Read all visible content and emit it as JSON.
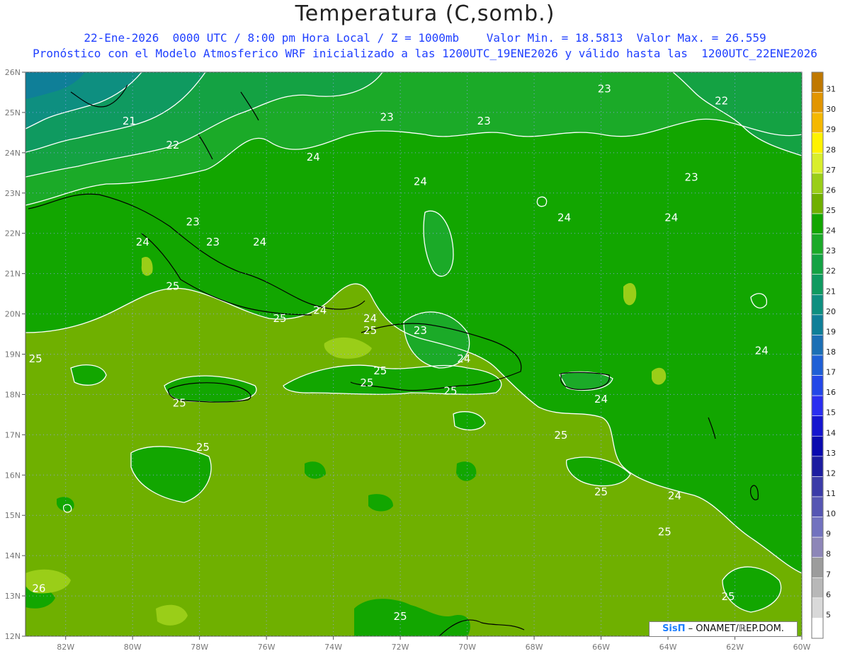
{
  "header": {
    "title": "Temperatura (C,somb.)",
    "line1": "22-Ene-2026  0000 UTC / 8:00 pm Hora Local / Z = 1000mb    Valor Min. = 18.5813  Valor Max. = 26.559",
    "line2": "Pronóstico con el Modelo Atmosferico WRF inicializado a las 1200UTC_19ENE2026 y válido hasta las  1200UTC_22ENE2026"
  },
  "map": {
    "lon_range": [
      -83.2,
      -60
    ],
    "lat_range": [
      12,
      26
    ],
    "lon_ticks": [
      {
        "lon": -82,
        "label": "82W"
      },
      {
        "lon": -80,
        "label": "80W"
      },
      {
        "lon": -78,
        "label": "78W"
      },
      {
        "lon": -76,
        "label": "76W"
      },
      {
        "lon": -74,
        "label": "74W"
      },
      {
        "lon": -72,
        "label": "72W"
      },
      {
        "lon": -70,
        "label": "70W"
      },
      {
        "lon": -68,
        "label": "68W"
      },
      {
        "lon": -66,
        "label": "66W"
      },
      {
        "lon": -64,
        "label": "64W"
      },
      {
        "lon": -62,
        "label": "62W"
      },
      {
        "lon": -60,
        "label": "60W"
      }
    ],
    "lat_ticks": [
      {
        "lat": 26,
        "label": "26N"
      },
      {
        "lat": 25,
        "label": "25N"
      },
      {
        "lat": 24,
        "label": "24N"
      },
      {
        "lat": 23,
        "label": "23N"
      },
      {
        "lat": 22,
        "label": "22N"
      },
      {
        "lat": 21,
        "label": "21N"
      },
      {
        "lat": 20,
        "label": "20N"
      },
      {
        "lat": 19,
        "label": "19N"
      },
      {
        "lat": 18,
        "label": "18N"
      },
      {
        "lat": 17,
        "label": "17N"
      },
      {
        "lat": 16,
        "label": "16N"
      },
      {
        "lat": 15,
        "label": "15N"
      },
      {
        "lat": 14,
        "label": "14N"
      },
      {
        "lat": 13,
        "label": "13N"
      },
      {
        "lat": 12,
        "label": "12N"
      }
    ],
    "contour_labels": [
      {
        "lon": -80.1,
        "lat": 24.7,
        "text": "21"
      },
      {
        "lon": -78.8,
        "lat": 24.1,
        "text": "22"
      },
      {
        "lon": -78.2,
        "lat": 22.2,
        "text": "23"
      },
      {
        "lon": -77.6,
        "lat": 21.7,
        "text": "23"
      },
      {
        "lon": -79.7,
        "lat": 21.7,
        "text": "24"
      },
      {
        "lon": -76.2,
        "lat": 21.7,
        "text": "24"
      },
      {
        "lon": -74.6,
        "lat": 23.8,
        "text": "24"
      },
      {
        "lon": -71.4,
        "lat": 23.2,
        "text": "24"
      },
      {
        "lon": -72.4,
        "lat": 24.8,
        "text": "23"
      },
      {
        "lon": -69.5,
        "lat": 24.7,
        "text": "23"
      },
      {
        "lon": -65.9,
        "lat": 25.5,
        "text": "23"
      },
      {
        "lon": -62.4,
        "lat": 25.2,
        "text": "22"
      },
      {
        "lon": -63.3,
        "lat": 23.3,
        "text": "23"
      },
      {
        "lon": -67.1,
        "lat": 22.3,
        "text": "24"
      },
      {
        "lon": -63.9,
        "lat": 22.3,
        "text": "24"
      },
      {
        "lon": -78.8,
        "lat": 20.6,
        "text": "25"
      },
      {
        "lon": -75.6,
        "lat": 19.8,
        "text": "25"
      },
      {
        "lon": -74.4,
        "lat": 20.0,
        "text": "24"
      },
      {
        "lon": -72.9,
        "lat": 19.8,
        "text": "24"
      },
      {
        "lon": -72.9,
        "lat": 19.5,
        "text": "25"
      },
      {
        "lon": -71.4,
        "lat": 19.5,
        "text": "23"
      },
      {
        "lon": -70.1,
        "lat": 18.8,
        "text": "24"
      },
      {
        "lon": -73.0,
        "lat": 18.2,
        "text": "25"
      },
      {
        "lon": -72.6,
        "lat": 18.5,
        "text": "25"
      },
      {
        "lon": -70.5,
        "lat": 18.0,
        "text": "25"
      },
      {
        "lon": -66.0,
        "lat": 17.8,
        "text": "24"
      },
      {
        "lon": -61.2,
        "lat": 19.0,
        "text": "24"
      },
      {
        "lon": -82.9,
        "lat": 18.8,
        "text": "25"
      },
      {
        "lon": -78.6,
        "lat": 17.7,
        "text": "25"
      },
      {
        "lon": -77.9,
        "lat": 16.6,
        "text": "25"
      },
      {
        "lon": -67.2,
        "lat": 16.9,
        "text": "25"
      },
      {
        "lon": -66.0,
        "lat": 15.5,
        "text": "25"
      },
      {
        "lon": -63.8,
        "lat": 15.4,
        "text": "24"
      },
      {
        "lon": -64.1,
        "lat": 14.5,
        "text": "25"
      },
      {
        "lon": -62.2,
        "lat": 12.9,
        "text": "25"
      },
      {
        "lon": -82.8,
        "lat": 13.1,
        "text": "26"
      },
      {
        "lon": -72.0,
        "lat": 12.4,
        "text": "25"
      }
    ]
  },
  "legend": {
    "levels": [
      {
        "value": "31",
        "color": "#c07800"
      },
      {
        "value": "30",
        "color": "#e29500"
      },
      {
        "value": "29",
        "color": "#f5b800"
      },
      {
        "value": "28",
        "color": "#fff200"
      },
      {
        "value": "27",
        "color": "#d9ee2c"
      },
      {
        "value": "26",
        "color": "#9ace18"
      },
      {
        "value": "25",
        "color": "#6fb000"
      },
      {
        "value": "24",
        "color": "#12a600"
      },
      {
        "value": "23",
        "color": "#1baa28"
      },
      {
        "value": "22",
        "color": "#14a243"
      },
      {
        "value": "21",
        "color": "#0f9a60"
      },
      {
        "value": "20",
        "color": "#0e8f80"
      },
      {
        "value": "19",
        "color": "#0f7f98"
      },
      {
        "value": "18",
        "color": "#1c6fb5"
      },
      {
        "value": "17",
        "color": "#1f5fd6"
      },
      {
        "value": "16",
        "color": "#2347e8"
      },
      {
        "value": "15",
        "color": "#2a2ef0"
      },
      {
        "value": "14",
        "color": "#1515cf"
      },
      {
        "value": "13",
        "color": "#0a0aaf"
      },
      {
        "value": "12",
        "color": "#1c1ca0"
      },
      {
        "value": "11",
        "color": "#3b3ba8"
      },
      {
        "value": "10",
        "color": "#5656b3"
      },
      {
        "value": "9",
        "color": "#7272bf"
      },
      {
        "value": "8",
        "color": "#8d86b8"
      },
      {
        "value": "7",
        "color": "#9c9c9c"
      },
      {
        "value": "6",
        "color": "#b8b8b8"
      },
      {
        "value": "5",
        "color": "#d9d9d9"
      },
      {
        "value": "",
        "color": "#ffffff"
      }
    ]
  },
  "credit": {
    "logo": "SisΠ",
    "text": " – ONAMET/ℝEP.DOM."
  }
}
